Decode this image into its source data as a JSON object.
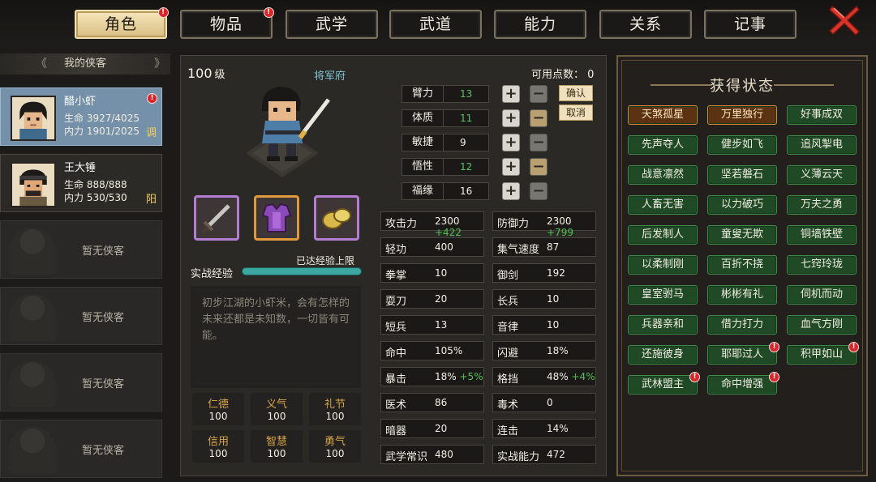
{
  "tabs": [
    {
      "label": "角色",
      "active": true,
      "badge": true
    },
    {
      "label": "物品",
      "active": false,
      "badge": true
    },
    {
      "label": "武学",
      "active": false,
      "badge": false
    },
    {
      "label": "武道",
      "active": false,
      "badge": false
    },
    {
      "label": "能力",
      "active": false,
      "badge": false
    },
    {
      "label": "关系",
      "active": false,
      "badge": false
    },
    {
      "label": "记事",
      "active": false,
      "badge": false
    }
  ],
  "badge_symbol": "!",
  "party": {
    "header": "我的侠客",
    "members": [
      {
        "name": "醋小虾",
        "hp_label": "生命",
        "hp": "3927/4025",
        "mp_label": "内力",
        "mp": "1901/2025",
        "mark": "调",
        "selected": true,
        "badge": true
      },
      {
        "name": "王大锤",
        "hp_label": "生命",
        "hp": "888/888",
        "mp_label": "内力",
        "mp": "530/530",
        "mark": "阳",
        "selected": false,
        "badge": false
      }
    ],
    "empty_label": "暂无侠客"
  },
  "character": {
    "level": "100",
    "level_unit": "级",
    "faction": "将军府",
    "xp_label": "实战经验",
    "xp_status": "已达经验上限",
    "xp_fraction": 1.0,
    "description": "初步江湖的小虾米，会有怎样的未来还都是未知数，一切皆有可能。",
    "virtues": [
      {
        "label": "仁德",
        "value": "100"
      },
      {
        "label": "义气",
        "value": "100"
      },
      {
        "label": "礼节",
        "value": "100"
      },
      {
        "label": "信用",
        "value": "100"
      },
      {
        "label": "智慧",
        "value": "100"
      },
      {
        "label": "勇气",
        "value": "100"
      }
    ],
    "equipment_icons": [
      "sword-icon",
      "armor-icon",
      "accessory-icon"
    ]
  },
  "attributes": {
    "points_label": "可用点数：",
    "points": "0",
    "confirm_label": "确认",
    "cancel_label": "取消",
    "items": [
      {
        "label": "臂力",
        "value": "13"
      },
      {
        "label": "体质",
        "value": "11"
      },
      {
        "label": "敏捷",
        "value": "9"
      },
      {
        "label": "悟性",
        "value": "12"
      },
      {
        "label": "福缘",
        "value": "16"
      }
    ]
  },
  "stats": {
    "left": [
      {
        "label": "攻击力",
        "value": "2300",
        "bonus": "+422"
      },
      {
        "label": "轻功",
        "value": "400",
        "bonus": ""
      },
      {
        "label": "拳掌",
        "value": "10",
        "bonus": ""
      },
      {
        "label": "耍刀",
        "value": "20",
        "bonus": ""
      },
      {
        "label": "短兵",
        "value": "13",
        "bonus": ""
      },
      {
        "label": "命中",
        "value": "105%",
        "bonus": ""
      },
      {
        "label": "暴击",
        "value": "18%",
        "bonus": "+5%"
      },
      {
        "label": "医术",
        "value": "86",
        "bonus": ""
      },
      {
        "label": "暗器",
        "value": "20",
        "bonus": ""
      },
      {
        "label": "武学常识",
        "value": "480",
        "bonus": ""
      }
    ],
    "right": [
      {
        "label": "防御力",
        "value": "2300",
        "bonus": "+799"
      },
      {
        "label": "集气速度",
        "value": "87",
        "bonus": ""
      },
      {
        "label": "御剑",
        "value": "192",
        "bonus": ""
      },
      {
        "label": "长兵",
        "value": "10",
        "bonus": ""
      },
      {
        "label": "音律",
        "value": "10",
        "bonus": ""
      },
      {
        "label": "闪避",
        "value": "18%",
        "bonus": ""
      },
      {
        "label": "格挡",
        "value": "48%",
        "bonus": "+4%"
      },
      {
        "label": "毒术",
        "value": "0",
        "bonus": ""
      },
      {
        "label": "连击",
        "value": "14%",
        "bonus": ""
      },
      {
        "label": "实战能力",
        "value": "472",
        "bonus": ""
      }
    ]
  },
  "status_panel": {
    "title": "获得状态",
    "tags": [
      {
        "label": "天煞孤星",
        "style": "orange",
        "badge": false
      },
      {
        "label": "万里独行",
        "style": "orange",
        "badge": false
      },
      {
        "label": "好事成双",
        "style": "green",
        "badge": false
      },
      {
        "label": "先声夺人",
        "style": "green",
        "badge": false
      },
      {
        "label": "健步如飞",
        "style": "green",
        "badge": false
      },
      {
        "label": "追风掣电",
        "style": "green",
        "badge": false
      },
      {
        "label": "战意凛然",
        "style": "green",
        "badge": false
      },
      {
        "label": "坚若磐石",
        "style": "green",
        "badge": false
      },
      {
        "label": "义薄云天",
        "style": "green",
        "badge": false
      },
      {
        "label": "人畜无害",
        "style": "green",
        "badge": false
      },
      {
        "label": "以力破巧",
        "style": "green",
        "badge": false
      },
      {
        "label": "万夫之勇",
        "style": "green",
        "badge": false
      },
      {
        "label": "后发制人",
        "style": "green",
        "badge": false
      },
      {
        "label": "童叟无欺",
        "style": "green",
        "badge": false
      },
      {
        "label": "铜墙铁壁",
        "style": "green",
        "badge": false
      },
      {
        "label": "以柔制刚",
        "style": "green",
        "badge": false
      },
      {
        "label": "百折不挠",
        "style": "green",
        "badge": false
      },
      {
        "label": "七窍玲珑",
        "style": "green",
        "badge": false
      },
      {
        "label": "皇室驸马",
        "style": "green",
        "badge": false
      },
      {
        "label": "彬彬有礼",
        "style": "green",
        "badge": false
      },
      {
        "label": "伺机而动",
        "style": "green",
        "badge": false
      },
      {
        "label": "兵器亲和",
        "style": "green",
        "badge": false
      },
      {
        "label": "借力打力",
        "style": "green",
        "badge": false
      },
      {
        "label": "血气方刚",
        "style": "green",
        "badge": false
      },
      {
        "label": "还施彼身",
        "style": "green",
        "badge": false
      },
      {
        "label": "耶耶过人",
        "style": "green",
        "badge": true
      },
      {
        "label": "积甲如山",
        "style": "green",
        "badge": true
      },
      {
        "label": "武林盟主",
        "style": "green",
        "badge": true
      },
      {
        "label": "命中增强",
        "style": "green",
        "badge": true
      }
    ]
  }
}
